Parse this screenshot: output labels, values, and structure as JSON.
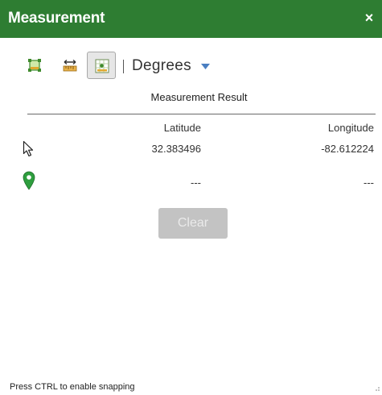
{
  "window": {
    "title": "Measurement",
    "close_glyph": "×"
  },
  "toolbar": {
    "tools": [
      {
        "name": "area",
        "icon": "area-icon",
        "active": false
      },
      {
        "name": "distance",
        "icon": "distance-icon",
        "active": false
      },
      {
        "name": "location",
        "icon": "location-icon",
        "active": true
      }
    ],
    "unit_selected": "Degrees",
    "unit_caret_icon": "caret-down-icon"
  },
  "result": {
    "header": "Measurement Result",
    "columns": [
      "Latitude",
      "Longitude"
    ],
    "rows": [
      {
        "icon": "mouse-cursor-icon",
        "latitude": "32.383496",
        "longitude": "-82.612224"
      },
      {
        "icon": "map-pin-icon",
        "latitude": "---",
        "longitude": "---"
      }
    ]
  },
  "clear_button": {
    "label": "Clear",
    "enabled": false
  },
  "status": {
    "text": "Press CTRL to enable snapping"
  },
  "colors": {
    "accent": "#2e7d32",
    "pin": "#2e9e3e",
    "caret": "#4a7fc1",
    "button_disabled": "#c3c3c3"
  }
}
